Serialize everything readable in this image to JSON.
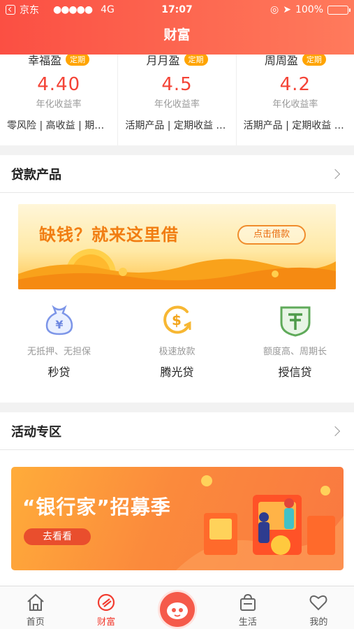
{
  "status_bar": {
    "carrier": "京东",
    "signal": "●●●●●",
    "network": "4G",
    "time": "17:07",
    "battery": "100%"
  },
  "header": {
    "title": "财富"
  },
  "products": [
    {
      "name": "幸福盈",
      "tag": "定期",
      "rate": "4.40",
      "rate_label": "年化收益率",
      "desc": "零风险 | 高收益 | 期限灵活"
    },
    {
      "name": "月月盈",
      "tag": "定期",
      "rate": "4.5",
      "rate_label": "年化收益率",
      "desc": "活期产品 | 定期收益 | 灵活"
    },
    {
      "name": "周周盈",
      "tag": "定期",
      "rate": "4.2",
      "rate_label": "年化收益率",
      "desc": "活期产品 | 定期收益 | 灵活"
    }
  ],
  "loan_section": {
    "title": "贷款产品",
    "banner": {
      "slogan": "缺钱？就来这里借",
      "button": "点击借款"
    },
    "items": [
      {
        "icon": "money-bag-icon",
        "sub": "无抵押、无担保",
        "name": "秒贷"
      },
      {
        "icon": "dollar-coin-icon",
        "sub": "极速放款",
        "name": "腾光贷"
      },
      {
        "icon": "yuan-shield-icon",
        "sub": "额度高、周期长",
        "name": "授信贷"
      }
    ]
  },
  "activity_section": {
    "title": "活动专区",
    "banner": {
      "title": "“银行家”招募季",
      "button": "去看看"
    }
  },
  "tabs": [
    {
      "label": "首页",
      "icon": "home-icon",
      "active": false
    },
    {
      "label": "财富",
      "icon": "wealth-icon",
      "active": true
    },
    {
      "label": "",
      "icon": "mascot-icon",
      "active": false
    },
    {
      "label": "生活",
      "icon": "shopping-bag-icon",
      "active": false
    },
    {
      "label": "我的",
      "icon": "heart-icon",
      "active": false
    }
  ],
  "colors": {
    "accent": "#f23c30",
    "header_start": "#fb4f43",
    "header_end": "#ff7a5c",
    "tag": "#ffa400"
  }
}
